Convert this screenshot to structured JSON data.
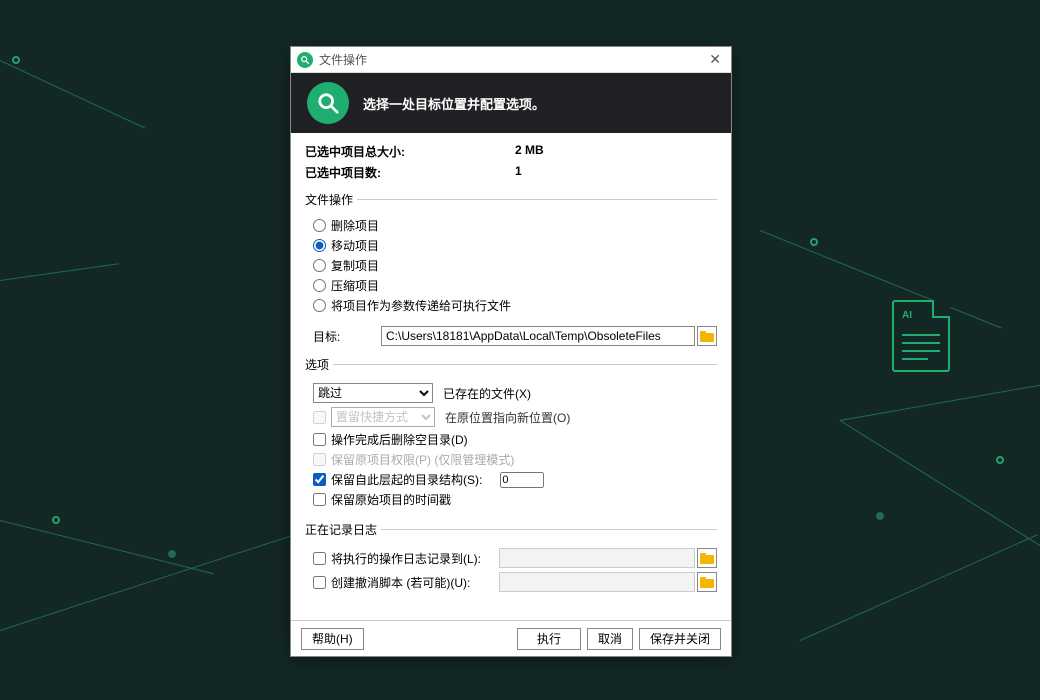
{
  "window": {
    "title": "文件操作"
  },
  "header": {
    "title": "选择一处目标位置并配置选项。"
  },
  "info": {
    "size_label": "已选中项目总大小:",
    "size_value": "2 MB",
    "count_label": "已选中项目数:",
    "count_value": "1"
  },
  "groups": {
    "operations_legend": "文件操作",
    "options_legend": "选项",
    "logging_legend": "正在记录日志"
  },
  "operations": {
    "delete": "删除项目",
    "move": "移动项目",
    "copy": "复制项目",
    "compress": "压缩项目",
    "exec": "将项目作为参数传递给可执行文件"
  },
  "target": {
    "label": "目标:",
    "value": "C:\\Users\\18181\\AppData\\Local\\Temp\\ObsoleteFiles"
  },
  "options": {
    "skip_select": "跳过",
    "existing_label": "已存在的文件(X)",
    "shortcut_select": "置留快捷方式",
    "shortcut_label": "在原位置指向新位置(O)",
    "del_empty": "操作完成后删除空目录(D)",
    "keep_perm": "保留原项目权限(P) (仅限管理模式)",
    "keep_struct": "保留自此层起的目录结构(S):",
    "keep_struct_value": "0",
    "keep_time": "保留原始项目的时间戳"
  },
  "logging": {
    "log_ops": "将执行的操作日志记录到(L):",
    "undo_script": "创建撤消脚本 (若可能)(U):"
  },
  "footer": {
    "help": "帮助(H)",
    "execute": "执行",
    "cancel": "取消",
    "save_close": "保存并关闭"
  }
}
